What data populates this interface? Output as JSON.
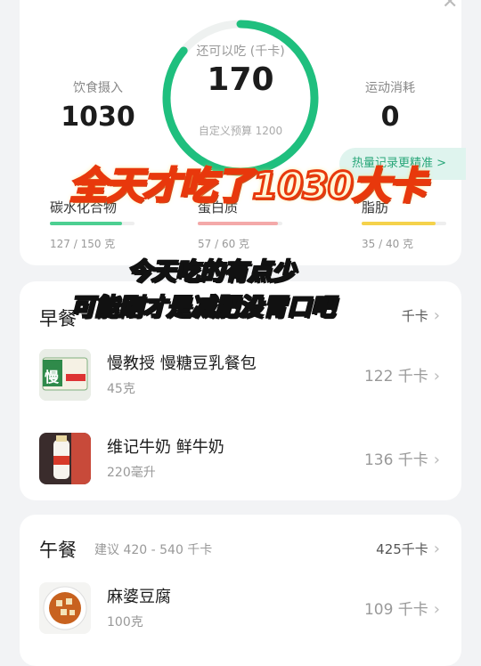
{
  "summary": {
    "intake_label": "饮食摄入",
    "intake_value": "1030",
    "remaining_label": "还可以吃 (千卡)",
    "remaining_value": "170",
    "budget_text": "自定义预算 1200",
    "burn_label": "运动消耗",
    "burn_value": "0",
    "ring_progress": 0.86,
    "ring_color": "#1fbf7e",
    "tip_text": "热量记录更精准 >",
    "close_icon": "close-icon"
  },
  "macros": [
    {
      "name": "碳水化合物",
      "amount": "127 / 150 克",
      "progress": 0.85,
      "color": "#4ccf91"
    },
    {
      "name": "蛋白质",
      "amount": "57 / 60 克",
      "progress": 0.95,
      "color": "#f4a9a9"
    },
    {
      "name": "脂肪",
      "amount": "35 / 40 克",
      "progress": 0.87,
      "color": "#f5d24b"
    }
  ],
  "breakfast": {
    "title": "早餐",
    "total": "千卡",
    "items": [
      {
        "name": "慢教授 慢糖豆乳餐包",
        "qty": "45克",
        "kcal": "122 千卡",
        "thumb_text": "慢"
      },
      {
        "name": "维记牛奶 鲜牛奶",
        "qty": "220毫升",
        "kcal": "136 千卡",
        "thumb_text": ""
      }
    ]
  },
  "lunch": {
    "title": "午餐",
    "suggest": "建议 420 - 540 千卡",
    "total": "425千卡",
    "items": [
      {
        "name": "麻婆豆腐",
        "qty": "100克",
        "kcal": "109 千卡"
      }
    ]
  },
  "captions": {
    "main": "全天才吃了1030大卡",
    "line1": "今天吃的有点少",
    "line2": "可能刚才是减肥没胃口吧"
  }
}
